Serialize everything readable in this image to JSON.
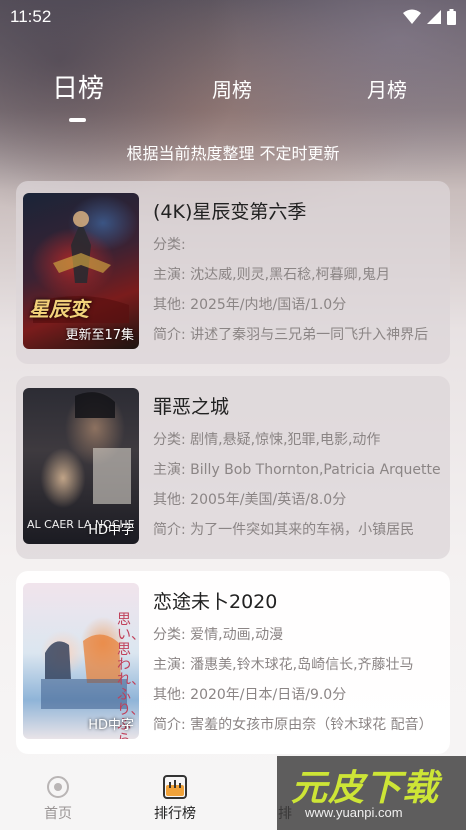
{
  "status_bar": {
    "time": "11:52"
  },
  "tabs": [
    {
      "label": "日榜",
      "active": true
    },
    {
      "label": "周榜",
      "active": false
    },
    {
      "label": "月榜",
      "active": false
    }
  ],
  "subtitle": "根据当前热度整理 不定时更新",
  "items": [
    {
      "title": "(4K)星辰变第六季",
      "category": "分类:",
      "cast": "主演:  沈达威,则灵,黑石稔,柯暮卿,鬼月",
      "other": "其他:  2025年/内地/国语/1.0分",
      "summary": "简介:  讲述了秦羽与三兄弟一同飞升入神界后",
      "badge": "更新至17集",
      "poster_text": "星辰变"
    },
    {
      "title": "罪恶之城",
      "category": "分类:  剧情,悬疑,惊悚,犯罪,电影,动作",
      "cast": "主演:  Billy Bob Thornton,Patricia Arquette",
      "other": "其他:  2005年/美国/英语/8.0分",
      "summary": "简介:        为了一件突如其来的车祸，小镇居民",
      "badge": "HD中字",
      "poster_text": "AL CAER LA NOCHE"
    },
    {
      "title": "恋途未卜2020",
      "category": "分类:  爱情,动画,动漫",
      "cast": "主演:  潘惠美,铃木球花,岛崎信长,齐藤壮马",
      "other": "其他:  2020年/日本/日语/9.0分",
      "summary": "简介:        害羞的女孩市原由奈（铃木球花 配音）",
      "badge": "HD中字",
      "poster_text": "思い、思われ、ふり、ふられ"
    }
  ],
  "bottom_nav": [
    {
      "label": "首页",
      "active": false
    },
    {
      "label": "排行榜",
      "active": true
    },
    {
      "label": "排",
      "active": false
    }
  ],
  "watermark": {
    "brand": "元皮下载",
    "url": "www.yuanpi.com"
  },
  "colors": {
    "accent": "#ffffff",
    "text_primary": "#222222",
    "text_secondary": "#8b8585",
    "watermark_green": "#cde536"
  }
}
